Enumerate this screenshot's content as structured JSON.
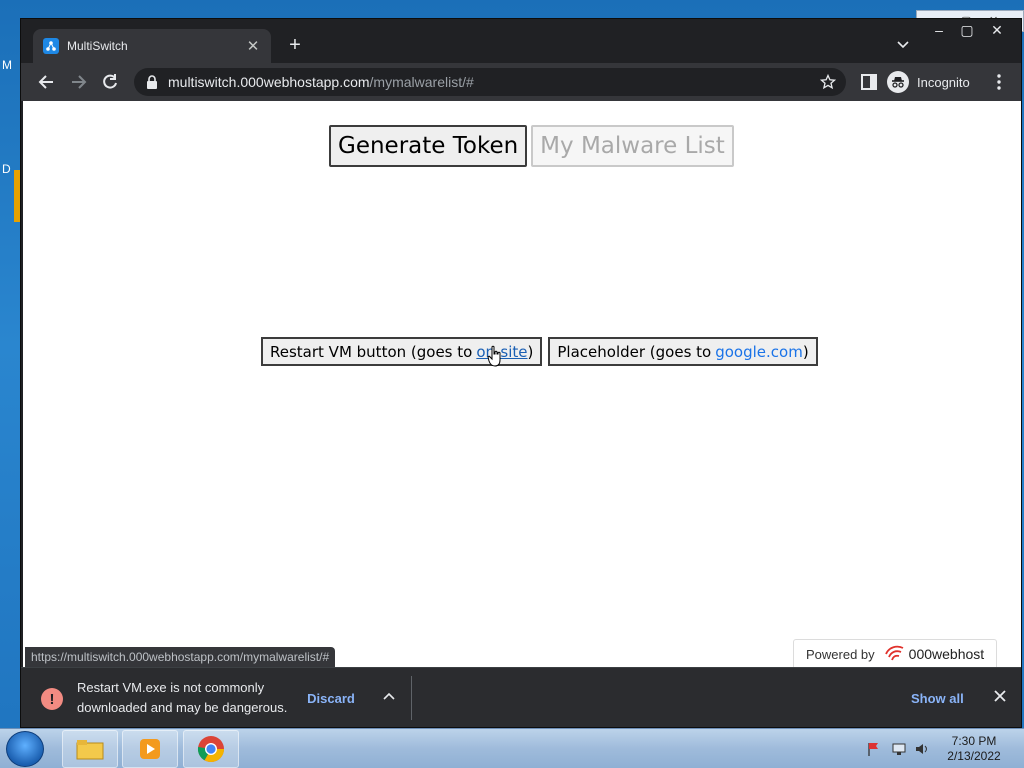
{
  "desktop": {
    "letter_top": "M",
    "letter_mid": "D"
  },
  "browser": {
    "tab_title": "MultiSwitch",
    "url_host": "multiswitch.000webhostapp.com",
    "url_path": "/mymalwarelist/#",
    "profile_label": "Incognito"
  },
  "page": {
    "generate_token_label": "Generate Token",
    "malware_list_label": "My Malware List",
    "restart_vm_text": "Restart VM button (goes to",
    "restart_vm_link": "on-site",
    "restart_vm_close": ")",
    "placeholder_text": "Placeholder (goes to",
    "placeholder_link": "google.com",
    "placeholder_close": ")",
    "hover_url": "https://multiswitch.000webhostapp.com/mymalwarelist/#",
    "powered_by": "Powered by",
    "host_brand": "000webhost"
  },
  "download_shelf": {
    "warning": "Restart VM.exe is not commonly downloaded and may be dangerous.",
    "discard_label": "Discard",
    "show_all_label": "Show all"
  },
  "taskbar": {
    "time": "7:30 PM",
    "date": "2/13/2022"
  },
  "colors": {
    "chrome_dark": "#202124",
    "chrome_toolbar": "#35363a",
    "link_blue": "#1a73e8",
    "warning_red": "#f28b82",
    "shelf_link": "#8ab4f8"
  }
}
